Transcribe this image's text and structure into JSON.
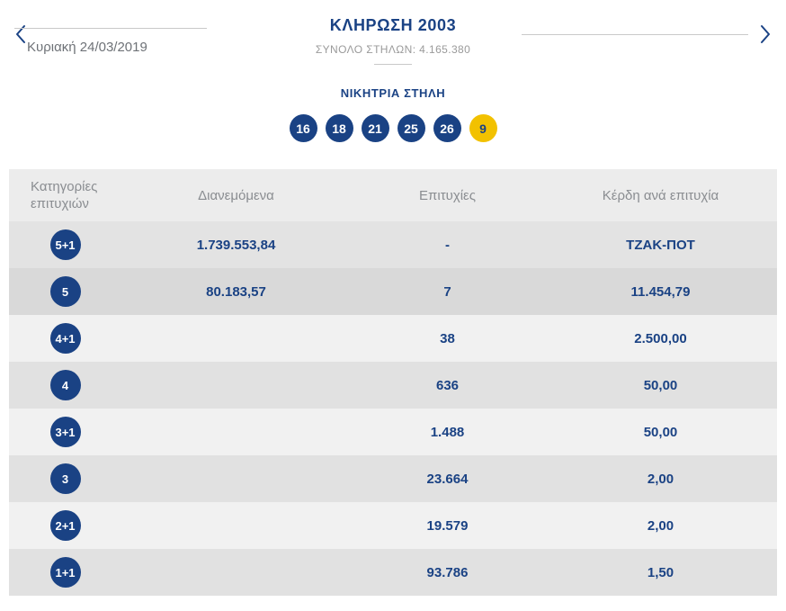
{
  "colors": {
    "primary_blue": "#1a4284",
    "joker_yellow": "#f2c100"
  },
  "header": {
    "date": "Κυριακή 24/03/2019",
    "title": "ΚΛΗΡΩΣΗ 2003",
    "subtitle": "ΣΥΝΟΛΟ ΣΤΗΛΩΝ: 4.165.380",
    "prev_icon": "chevron-left",
    "next_icon": "chevron-right"
  },
  "winning": {
    "label": "ΝΙΚΗΤΡΙΑ ΣΤΗΛΗ",
    "numbers": [
      "16",
      "18",
      "21",
      "25",
      "26"
    ],
    "joker": "9"
  },
  "table": {
    "headers": [
      "Κατηγορίες\nεπιτυχιών",
      "Διανεμόμενα",
      "Επιτυχίες",
      "Κέρδη ανά επιτυχία"
    ],
    "rows": [
      {
        "category": "5+1",
        "distributed": "1.739.553,84",
        "wins": "-",
        "prize": "ΤΖΑΚ-ΠΟΤ"
      },
      {
        "category": "5",
        "distributed": "80.183,57",
        "wins": "7",
        "prize": "11.454,79"
      },
      {
        "category": "4+1",
        "distributed": "",
        "wins": "38",
        "prize": "2.500,00"
      },
      {
        "category": "4",
        "distributed": "",
        "wins": "636",
        "prize": "50,00"
      },
      {
        "category": "3+1",
        "distributed": "",
        "wins": "1.488",
        "prize": "50,00"
      },
      {
        "category": "3",
        "distributed": "",
        "wins": "23.664",
        "prize": "2,00"
      },
      {
        "category": "2+1",
        "distributed": "",
        "wins": "19.579",
        "prize": "2,00"
      },
      {
        "category": "1+1",
        "distributed": "",
        "wins": "93.786",
        "prize": "1,50"
      }
    ]
  }
}
